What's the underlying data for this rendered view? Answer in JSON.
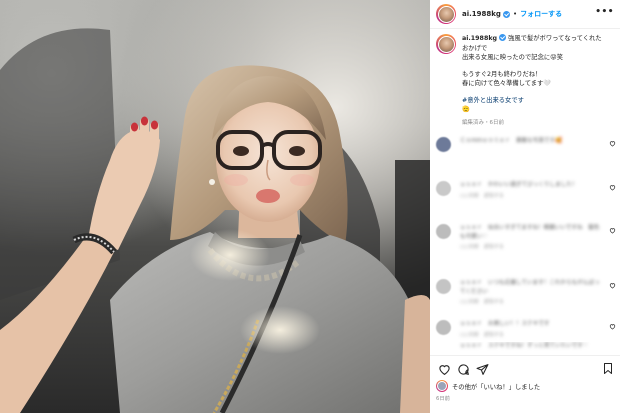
{
  "post": {
    "username": "ai.1988kg",
    "follow_label": "フォローする",
    "more_label": "•••",
    "caption": {
      "username": "ai.1988kg",
      "line1": "強風で髪がボワってなってくれた",
      "line2": "おかげで",
      "line3": "出来る女風に映ったので記念に😝笑",
      "line4": "もうすぐ2月も終わりだね！",
      "line5": "春に向けて色々準備してます🤍",
      "hashtag": "#意外と出来る女です",
      "emoji_line": "🫡",
      "meta": "編集済み・6日前"
    },
    "comments": [
      {
        "text": "Ｃｏｍｍｅｎｔｅｒ　素敵な写真です🥰",
        "meta": ""
      },
      {
        "text": "ｕｓｅｒ　かわいい過ぎてびっくりしました！",
        "meta": "○○日前　返信する"
      },
      {
        "text": "ｕｓｅｒ　似合いすぎてますね！眼鏡いいですね　髪色も可愛い♡",
        "meta": "○○日前　返信する"
      },
      {
        "text": "ｕｓｅｒ　いつも応援しています！これからもがんばってください",
        "meta": "○○日前　返信する"
      },
      {
        "text": "ｕｓｅｒ　お美しい！！ステキです",
        "meta": "○○日前　返信する"
      },
      {
        "text": "ｕｓｅｒ　ステキですね！ずっと見ていたいです♡",
        "meta": "○○日前　返信する"
      }
    ],
    "likes": {
      "prefix": "",
      "suffix": "その他が「いいね！」しました"
    },
    "timestamp": "6日前"
  },
  "icons": {
    "like": "heart-icon",
    "comment": "comment-icon",
    "share": "share-icon",
    "save": "bookmark-icon",
    "verified": "verified-badge-icon"
  },
  "colors": {
    "link_blue": "#0095f6",
    "verified_blue": "#3897f0",
    "text": "#262626",
    "muted": "#8e8e8e"
  }
}
